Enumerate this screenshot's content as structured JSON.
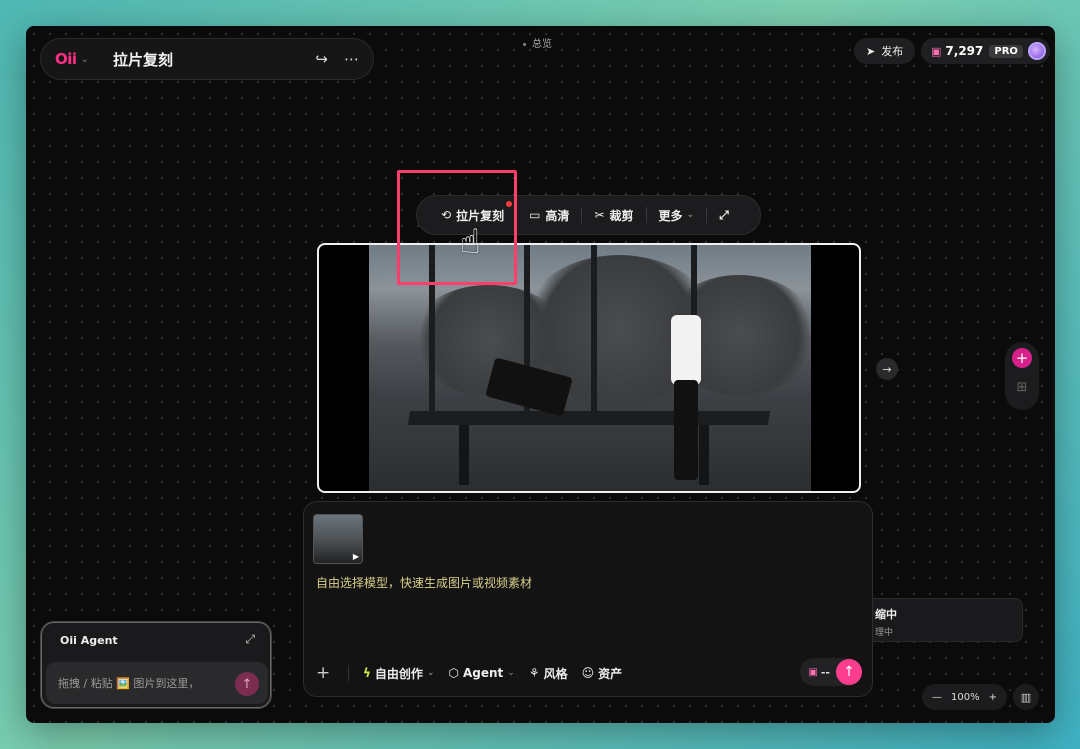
{
  "header": {
    "logo": "Oii",
    "title": "拉片复刻",
    "overview_label": "总览",
    "publish_label": "发布",
    "credits": "7,297",
    "plan_badge": "PRO"
  },
  "toolbar": {
    "items": [
      {
        "label": "拉片复刻",
        "icon": "remix-icon"
      },
      {
        "label": "高清",
        "icon": "hd-icon"
      },
      {
        "label": "裁剪",
        "icon": "scissors-icon"
      },
      {
        "label": "更多",
        "icon": "chevron-down-icon"
      }
    ]
  },
  "side_card": {
    "title": "缩中",
    "subtitle": "理中"
  },
  "composer": {
    "prompt_placeholder": "自由选择模型，快速生成图片或视频素材",
    "mode_label": "自由创作",
    "agent_label": "Agent",
    "style_label": "风格",
    "assets_label": "资产",
    "cost": "--"
  },
  "agent_panel": {
    "title": "Oii Agent",
    "placeholder": "拖拽 / 粘贴 🖼️ 图片到这里，"
  },
  "zoom": {
    "level": "100%"
  },
  "colors": {
    "accent": "#ff3d8e",
    "mode_accent": "#d8e84a",
    "highlight": "#ff3d6a"
  }
}
